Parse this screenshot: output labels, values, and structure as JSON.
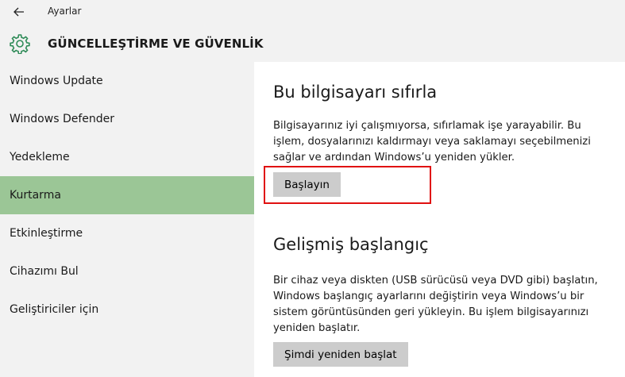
{
  "window": {
    "title": "Ayarlar"
  },
  "header": {
    "title": "GÜNCELLEŞTİRME VE GÜVENLİK",
    "icon": "gear-icon",
    "icon_color": "#2e8b57"
  },
  "sidebar": {
    "active_color": "#9bc696",
    "items": [
      {
        "label": "Windows Update"
      },
      {
        "label": "Windows Defender"
      },
      {
        "label": "Yedekleme"
      },
      {
        "label": "Kurtarma",
        "active": true
      },
      {
        "label": "Etkinleştirme"
      },
      {
        "label": "Cihazımı Bul"
      },
      {
        "label": "Geliştiriciler için"
      }
    ]
  },
  "reset": {
    "heading": "Bu bilgisayarı sıfırla",
    "description": "Bilgisayarınız iyi çalışmıyorsa, sıfırlamak işe yarayabilir. Bu işlem, dosyalarınızı kaldırmayı veya saklamayı seçebilmenizi sağlar ve ardından Windows’u yeniden yükler.",
    "button_label": "Başlayın",
    "highlight_color": "#e01010"
  },
  "advanced": {
    "heading": "Gelişmiş başlangıç",
    "description": "Bir cihaz veya diskten (USB sürücüsü veya DVD gibi) başlatın, Windows başlangıç ayarlarını değiştirin veya Windows’u bir sistem görüntüsünden geri yükleyin. Bu işlem bilgisayarınızı yeniden başlatır.",
    "button_label": "Şimdi yeniden başlat"
  }
}
